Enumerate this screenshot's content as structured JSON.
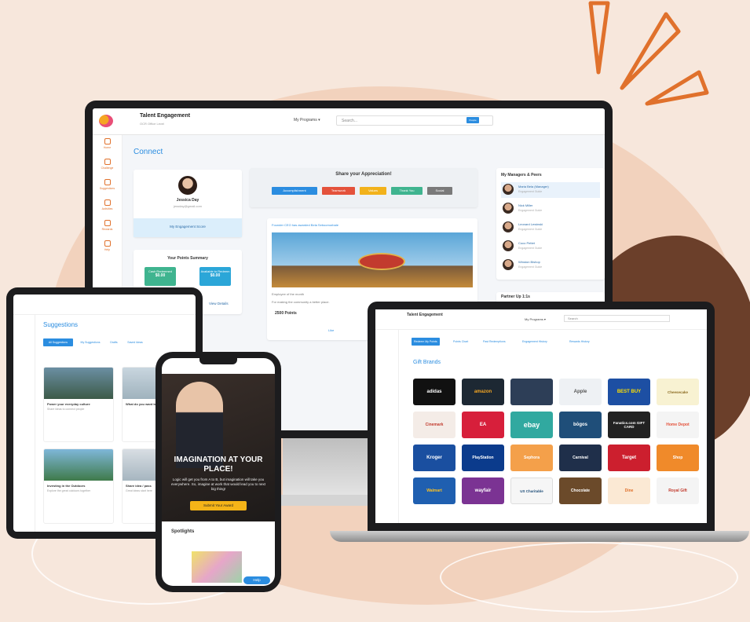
{
  "desktop": {
    "app_title": "Talent Engagement",
    "subtitle": "OCR Office Level",
    "my_programs": "My Programs ▾",
    "search_placeholder": "Search...",
    "search_button": "People",
    "sidebar": [
      "Home",
      "Challenge",
      "Suggestions",
      "Activities",
      "Rewards",
      "Help"
    ],
    "page_heading": "Connect",
    "profile": {
      "name": "Jessica Day",
      "email": "jessday@gmail.com",
      "score_label": "My Engagement Score"
    },
    "points_summary": {
      "title": "Your Points Summary",
      "cash_label": "Cash Redeemed",
      "cash_value": "$0.00",
      "available_label": "Available to Redeem",
      "available_value": "$0.00",
      "view_details": "View Details"
    },
    "appreciation": {
      "title": "Share your Appreciation!",
      "tags": [
        "Accomplishment",
        "Teamwork",
        "Values",
        "Thank You",
        "Social"
      ]
    },
    "feed": {
      "header": "Founder CEO has awarded Bela Seboomorbale",
      "line1": "Employee of the month",
      "line2": "For making the community a better place.",
      "points": "2500 Points",
      "like": "Like"
    },
    "managers": {
      "title": "My Managers & Peers",
      "people": [
        {
          "name": "Maria Bela (Manager)",
          "role": "Engagement Guide"
        },
        {
          "name": "Nick Miller",
          "role": "Engagement Guide"
        },
        {
          "name": "Leonard Lewinski",
          "role": "Engagement Guide"
        },
        {
          "name": "Coco Pettet",
          "role": "Engagement Guide"
        },
        {
          "name": "Winston Bishop",
          "role": "Engagement Guide"
        }
      ]
    },
    "partner": "Partner Up 1:1s"
  },
  "tablet": {
    "heading": "Suggestions",
    "tabs": [
      "All Suggestions",
      "My Suggestions",
      "Drafts",
      "Saved Ideas"
    ],
    "cards": [
      {
        "title": "Power your everyday culture",
        "desc": "Share ideas to connect people"
      },
      {
        "title": "What do you want to"
      },
      {
        "title": "Investing in the Outdoors",
        "desc": "Explore the great outdoors together"
      },
      {
        "title": "Share idea / pass",
        "desc": "Great ideas start here"
      }
    ]
  },
  "phone": {
    "headline": "IMAGINATION AT YOUR PLACE!",
    "body": "Logic will get you from A to B, but imagination will take you everywhere. So, imagine at work that would lead you to next big thing!",
    "button": "Submit Your Award",
    "section": "Spotlights",
    "help": "Help"
  },
  "laptop": {
    "app_title": "Talent Engagement",
    "my_programs": "My Programs ▾",
    "search_placeholder": "Search",
    "tabs": [
      "Redeem My Points",
      "Points Chart",
      "Past Redemptions",
      "Engagement History",
      "Rewards History"
    ],
    "heading": "Gift Brands",
    "brands": [
      [
        "adidas",
        "amazon",
        "",
        "Apple",
        "BEST BUY",
        "Cheesecake"
      ],
      [
        "Cinemark",
        "EA",
        "ebay",
        "bōgos",
        "Fanatics.com GIFT CARD",
        "Home Depot"
      ],
      [
        "Kroger",
        "PlayStation",
        "Sephora",
        "Carnival",
        "Target",
        "Shop"
      ],
      [
        "Walmart",
        "wayfair",
        "US Charitable",
        "Chocolate",
        "Dine",
        "Royal Gift"
      ]
    ]
  },
  "colors": {
    "brand_blue": "#2b8de0",
    "accent_orange": "#e0712c",
    "green": "#3fb48f",
    "bg_peach": "#f7e7dc"
  }
}
